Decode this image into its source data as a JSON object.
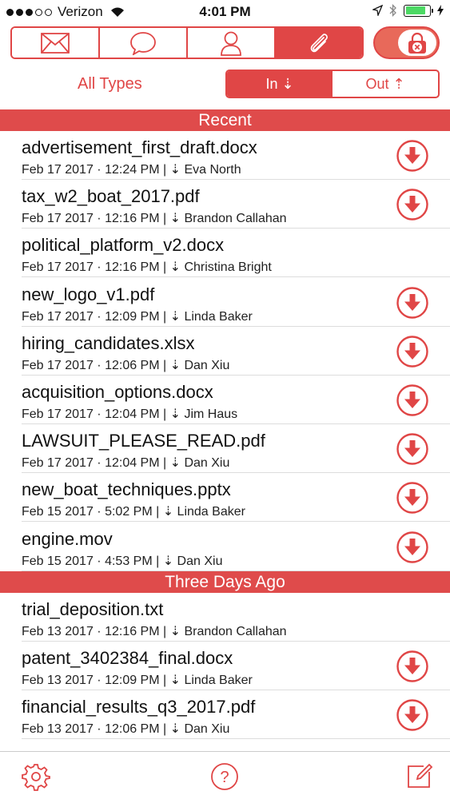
{
  "status_bar": {
    "carrier": "Verizon",
    "time": "4:01 PM",
    "battery_level": 0.85
  },
  "top_tabs": [
    {
      "name": "mail",
      "icon": "envelope-icon",
      "active": false
    },
    {
      "name": "messages",
      "icon": "chat-bubble-icon",
      "active": false
    },
    {
      "name": "contacts",
      "icon": "person-icon",
      "active": false
    },
    {
      "name": "attachments",
      "icon": "paperclip-icon",
      "active": true
    }
  ],
  "lock_toggle": {
    "icon": "lock-icon",
    "on": true
  },
  "filter": {
    "type_label": "All Types",
    "in_label": "In ⇣",
    "out_label": "Out ⇡"
  },
  "sections": [
    {
      "title": "Recent",
      "items": [
        {
          "filename": "advertisement_first_draft.docx",
          "meta": "Feb 17 2017 · 12:24 PM | ⇣ Eva North",
          "download": true
        },
        {
          "filename": "tax_w2_boat_2017.pdf",
          "meta": "Feb 17 2017 · 12:16 PM | ⇣ Brandon Callahan",
          "download": true
        },
        {
          "filename": "political_platform_v2.docx",
          "meta": "Feb 17 2017 · 12:16 PM | ⇣ Christina Bright",
          "download": false
        },
        {
          "filename": "new_logo_v1.pdf",
          "meta": "Feb 17 2017 · 12:09 PM | ⇣ Linda Baker",
          "download": true
        },
        {
          "filename": "hiring_candidates.xlsx",
          "meta": "Feb 17 2017 · 12:06 PM | ⇣ Dan Xiu",
          "download": true
        },
        {
          "filename": "acquisition_options.docx",
          "meta": "Feb 17 2017 · 12:04 PM | ⇣ Jim Haus",
          "download": true
        },
        {
          "filename": "LAWSUIT_PLEASE_READ.pdf",
          "meta": "Feb 17 2017 · 12:04 PM | ⇣ Dan Xiu",
          "download": true
        },
        {
          "filename": "new_boat_techniques.pptx",
          "meta": "Feb 15 2017 · 5:02 PM | ⇣ Linda Baker",
          "download": true
        },
        {
          "filename": "engine.mov",
          "meta": "Feb 15 2017 · 4:53 PM | ⇣ Dan Xiu",
          "download": true
        }
      ]
    },
    {
      "title": "Three Days Ago",
      "items": [
        {
          "filename": "trial_deposition.txt",
          "meta": "Feb 13 2017 · 12:16 PM | ⇣ Brandon Callahan",
          "download": false
        },
        {
          "filename": "patent_3402384_final.docx",
          "meta": "Feb 13 2017 · 12:09 PM | ⇣ Linda Baker",
          "download": true
        },
        {
          "filename": "financial_results_q3_2017.pdf",
          "meta": "Feb 13 2017 · 12:06 PM | ⇣ Dan Xiu",
          "download": true
        }
      ]
    }
  ],
  "bottom_bar": [
    {
      "icon": "gear-icon"
    },
    {
      "icon": "help-icon"
    },
    {
      "icon": "compose-icon"
    }
  ],
  "accent_color": "#e04646"
}
